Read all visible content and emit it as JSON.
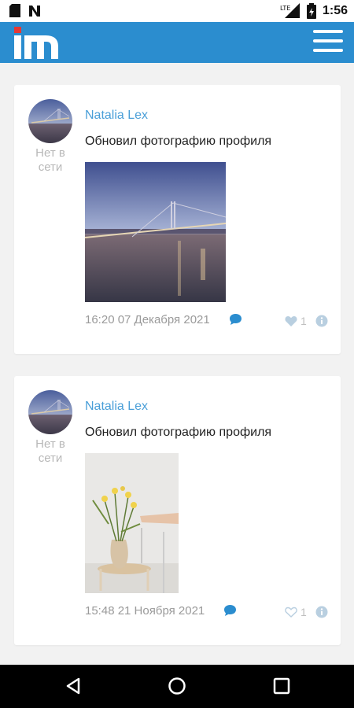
{
  "status_bar": {
    "time": "1:56",
    "lte_label": "LTE",
    "icons": [
      "sd-card-icon",
      "n-notification-icon",
      "lte-signal-icon",
      "battery-icon"
    ]
  },
  "app_bar": {
    "logo_icon": "im-logo-icon",
    "menu_icon": "hamburger-menu-icon"
  },
  "posts": [
    {
      "author": "Natalia Lex",
      "presence": "Нет в сети",
      "text": "Обновил фотографию профиля",
      "timestamp": "16:20 07 Декабря 2021",
      "likes": "1",
      "photo": "bridge-photo"
    },
    {
      "author": "Natalia Lex",
      "presence": "Нет в сети",
      "text": "Обновил фотографию профиля",
      "timestamp": "15:48 21 Ноября 2021",
      "likes": "1",
      "photo": "flowers-photo"
    }
  ],
  "colors": {
    "brand": "#2b8dcf",
    "link": "#4a9fd8",
    "muted": "#9a9a9a",
    "logo_dot": "#e53935"
  }
}
